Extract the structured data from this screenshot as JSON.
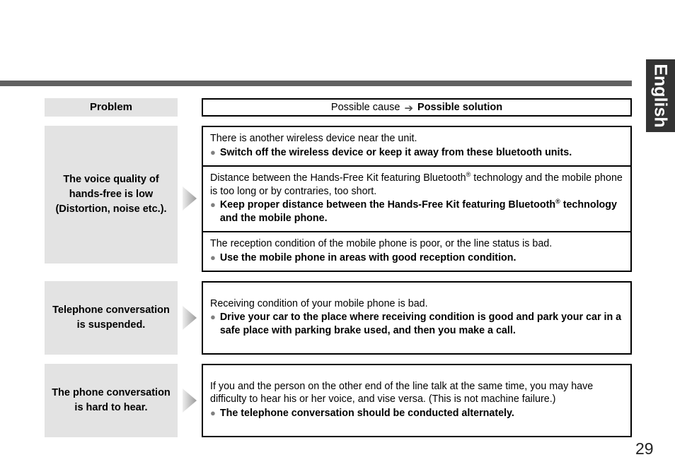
{
  "page": {
    "language_tab": "English",
    "page_number": "29"
  },
  "table": {
    "header": {
      "problem_label": "Problem",
      "cause_label": "Possible cause",
      "arrow_icon": "right-arrow-icon",
      "solution_label": "Possible solution"
    },
    "bullet_icon": "bullet-dot-icon",
    "arrow_icon": "triangle-right-icon",
    "rows": [
      {
        "problem": "The voice quality of hands-free is low (Distortion, noise etc.).",
        "blocks": [
          {
            "cause": "There is another wireless device near the unit.",
            "solution": "Switch off the wireless device or keep it away from these bluetooth units."
          },
          {
            "cause_pre": "Distance between the Hands-Free Kit featuring Bluetooth",
            "cause_reg": "®",
            "cause_post": " technology and the mobile phone is too long or by contraries, too short.",
            "solution_pre": "Keep proper distance between the Hands-Free Kit featuring Bluetooth",
            "solution_reg": "®",
            "solution_post": " technology and the mobile phone."
          },
          {
            "cause": "The reception condition of the mobile phone is poor, or the line status is bad.",
            "solution": "Use the mobile phone in areas with good reception condition."
          }
        ]
      },
      {
        "problem": "Telephone conversation is suspended.",
        "blocks": [
          {
            "cause": "Receiving condition of your mobile phone is bad.",
            "solution": "Drive your car to the place where receiving condition is good and park your car in a safe place with parking brake used, and then you make a call."
          }
        ]
      },
      {
        "problem": "The phone conversation is hard to hear.",
        "blocks": [
          {
            "cause": "If you and the person on the other end of the line talk at the same time, you may have difficulty to hear his or her voice, and vise versa. (This is not machine failure.)",
            "solution": "The telephone conversation should be conducted alternately."
          }
        ]
      }
    ]
  },
  "colors": {
    "rule": "#616161",
    "tab_bg": "#333333",
    "problem_bg": "#e3e3e3",
    "bullet": "#808080",
    "border": "#000000"
  }
}
